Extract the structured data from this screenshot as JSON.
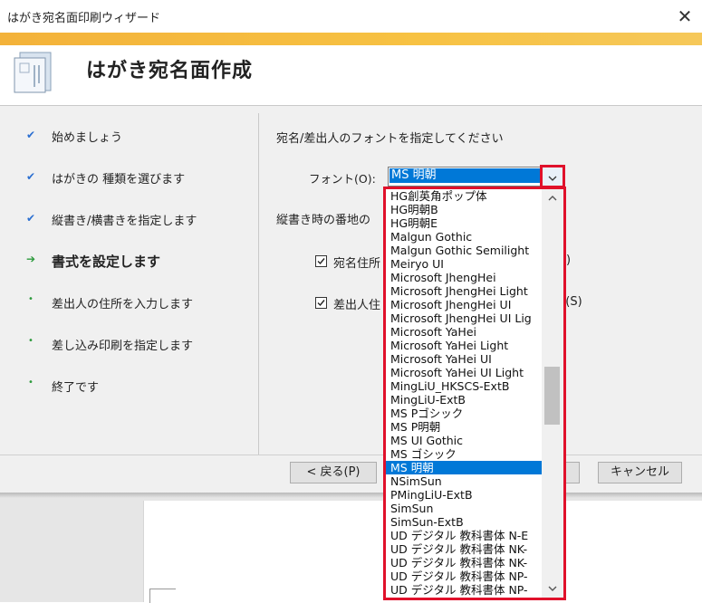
{
  "window": {
    "title": "はがき宛名面印刷ウィザード"
  },
  "header": {
    "title": "はがき宛名面作成"
  },
  "steps": [
    {
      "label": "始めましょう",
      "state": "done"
    },
    {
      "label": "はがきの 種類を選びます",
      "state": "done"
    },
    {
      "label": "縦書き/横書きを指定します",
      "state": "done"
    },
    {
      "label": "書式を設定します",
      "state": "current"
    },
    {
      "label": "差出人の住所を入力します",
      "state": "pending"
    },
    {
      "label": "差し込み印刷を指定します",
      "state": "pending"
    },
    {
      "label": "終了です",
      "state": "pending"
    }
  ],
  "main": {
    "instruction": "宛名/差出人のフォントを指定してください",
    "font_label": "フォント(O):",
    "font_value": "MS 明朝",
    "vertical_number_label": "縦書き時の番地の",
    "option1_label": "宛名住所",
    "option1_checked": true,
    "option1_tail": "R)",
    "option2_label": "差出人住",
    "option2_checked": true,
    "option2_tail": "S(S)"
  },
  "footer": {
    "back_label": "< 戻る(P)",
    "cancel_label": "キャンセル"
  },
  "dropdown": {
    "items": [
      "HG創英角ポップ体",
      "HG明朝B",
      "HG明朝E",
      "Malgun Gothic",
      "Malgun Gothic Semilight",
      "Meiryo UI",
      "Microsoft JhengHei",
      "Microsoft JhengHei Light",
      "Microsoft JhengHei UI",
      "Microsoft JhengHei UI Lig",
      "Microsoft YaHei",
      "Microsoft YaHei Light",
      "Microsoft YaHei UI",
      "Microsoft YaHei UI Light",
      "MingLiU_HKSCS-ExtB",
      "MingLiU-ExtB",
      "MS Pゴシック",
      "MS P明朝",
      "MS UI Gothic",
      "MS ゴシック",
      "MS 明朝",
      "NSimSun",
      "PMingLiU-ExtB",
      "SimSun",
      "SimSun-ExtB",
      "UD デジタル 教科書体 N-E",
      "UD デジタル 教科書体 NK-",
      "UD デジタル 教科書体 NK-",
      "UD デジタル 教科書体 NP-",
      "UD デジタル 教科書体 NP-"
    ],
    "selected": "MS 明朝"
  },
  "colors": {
    "accent": "#f7c243",
    "selection": "#0078d7",
    "highlight_outline": "#e0112b",
    "check": "#2b6fd1",
    "step_marker": "#2c9a3c"
  }
}
